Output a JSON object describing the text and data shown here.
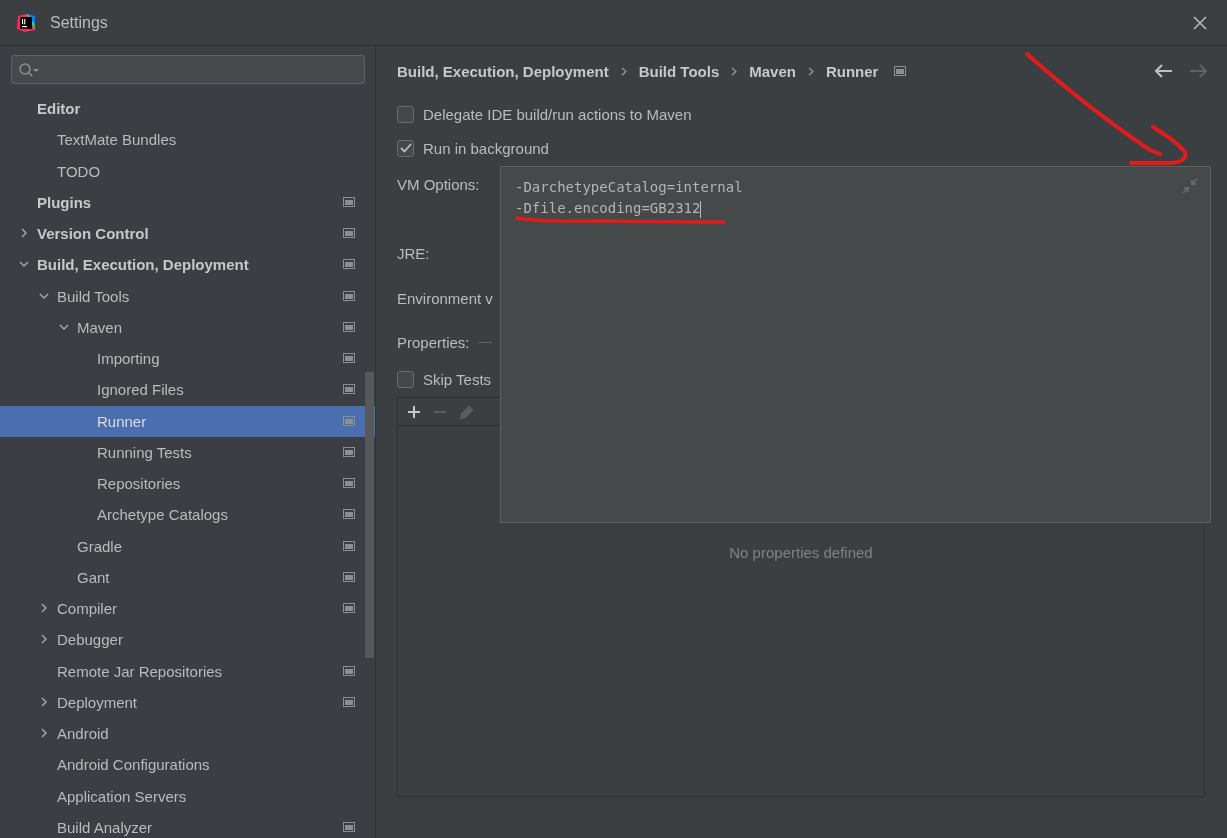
{
  "window": {
    "title": "Settings"
  },
  "sidebar": {
    "items": [
      {
        "label": "Editor",
        "selected": false,
        "page_icon": false,
        "children": [
          {
            "label": "TextMate Bundles",
            "selected": false,
            "page_icon": false
          },
          {
            "label": "TODO",
            "selected": false,
            "page_icon": false
          }
        ]
      },
      {
        "label": "Plugins",
        "selected": false,
        "page_icon": true
      },
      {
        "label": "Version Control",
        "selected": false,
        "page_icon": true,
        "expanded": false
      },
      {
        "label": "Build, Execution, Deployment",
        "selected": false,
        "page_icon": true,
        "expanded": true,
        "children": [
          {
            "label": "Build Tools",
            "selected": false,
            "page_icon": true,
            "expanded": true,
            "children": [
              {
                "label": "Maven",
                "selected": false,
                "page_icon": true,
                "expanded": true,
                "children": [
                  {
                    "label": "Importing",
                    "selected": false,
                    "page_icon": true
                  },
                  {
                    "label": "Ignored Files",
                    "selected": false,
                    "page_icon": true
                  },
                  {
                    "label": "Runner",
                    "selected": true,
                    "page_icon": true
                  },
                  {
                    "label": "Running Tests",
                    "selected": false,
                    "page_icon": true
                  },
                  {
                    "label": "Repositories",
                    "selected": false,
                    "page_icon": true
                  },
                  {
                    "label": "Archetype Catalogs",
                    "selected": false,
                    "page_icon": true
                  }
                ]
              },
              {
                "label": "Gradle",
                "selected": false,
                "page_icon": true
              },
              {
                "label": "Gant",
                "selected": false,
                "page_icon": true
              }
            ]
          },
          {
            "label": "Compiler",
            "selected": false,
            "page_icon": true,
            "expanded": false
          },
          {
            "label": "Debugger",
            "selected": false,
            "page_icon": false,
            "expanded": false
          },
          {
            "label": "Remote Jar Repositories",
            "selected": false,
            "page_icon": true
          },
          {
            "label": "Deployment",
            "selected": false,
            "page_icon": true,
            "expanded": false
          },
          {
            "label": "Android",
            "selected": false,
            "page_icon": false,
            "expanded": false
          },
          {
            "label": "Android Configurations",
            "selected": false,
            "page_icon": false
          },
          {
            "label": "Application Servers",
            "selected": false,
            "page_icon": false
          },
          {
            "label": "Build Analyzer",
            "selected": false,
            "page_icon": true
          }
        ]
      }
    ]
  },
  "breadcrumb": {
    "items": [
      "Build, Execution, Deployment",
      "Build Tools",
      "Maven",
      "Runner"
    ],
    "page_icon": true
  },
  "nav": {
    "back_disabled": false,
    "forward_disabled": true
  },
  "options": [
    {
      "label": "Delegate IDE build/run actions to Maven",
      "checked": false
    },
    {
      "label": "Run in background",
      "checked": true
    }
  ],
  "form": {
    "vm_options_label": "VM Options:",
    "jre_label": "JRE:",
    "environment_label": "Environment v",
    "properties_label": "Properties:"
  },
  "skip_tests": {
    "label": "Skip Tests",
    "checked": false
  },
  "properties_table": {
    "empty_text": "No properties defined",
    "toolbar": [
      {
        "kind": "add",
        "disabled": false
      },
      {
        "kind": "remove",
        "disabled": true
      },
      {
        "kind": "edit",
        "disabled": true
      }
    ]
  },
  "vm_options_editor": {
    "lines": [
      "-DarchetypeCatalog=internal",
      "-Dfile.encoding=GB2312"
    ]
  }
}
